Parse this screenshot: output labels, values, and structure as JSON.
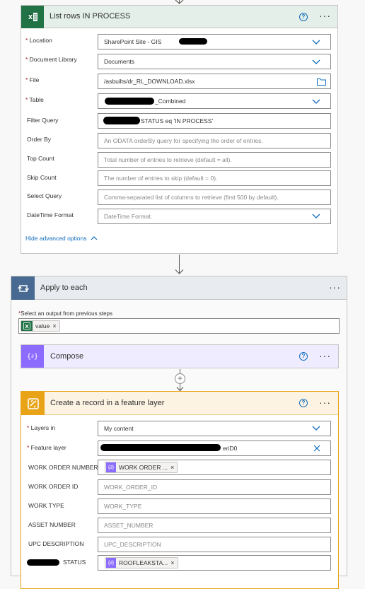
{
  "list_rows": {
    "title": "List rows IN PROCESS",
    "fields": [
      {
        "label": "Location",
        "required": true,
        "value": "SharePoint Site - GIS",
        "type": "dropdown"
      },
      {
        "label": "Document Library",
        "required": true,
        "value": "Documents",
        "type": "dropdown"
      },
      {
        "label": "File",
        "required": true,
        "value": "/asbuilts/dr_RL_DOWNLOAD.xlsx",
        "type": "file"
      },
      {
        "label": "Table",
        "required": true,
        "value": "_Combined",
        "type": "dropdown"
      },
      {
        "label": "Filter Query",
        "required": false,
        "value": "STATUS eq 'IN PROCESS'",
        "type": "text"
      },
      {
        "label": "Order By",
        "required": false,
        "placeholder": "An ODATA orderBy query for specifying the order of entries.",
        "type": "text"
      },
      {
        "label": "Top Count",
        "required": false,
        "placeholder": "Total number of entries to retrieve (default = all).",
        "type": "text"
      },
      {
        "label": "Skip Count",
        "required": false,
        "placeholder": "The number of entries to skip (default = 0).",
        "type": "text"
      },
      {
        "label": "Select Query",
        "required": false,
        "placeholder": "Comma-separated list of columns to retrieve (first 500 by default).",
        "type": "text"
      },
      {
        "label": "DateTime Format",
        "required": false,
        "placeholder": "DateTime Format.",
        "type": "dropdown"
      }
    ],
    "hide_advanced": "Hide advanced options"
  },
  "apply_each": {
    "title": "Apply to each",
    "select_label": "Select an output from previous steps",
    "token": "value"
  },
  "compose": {
    "title": "Compose"
  },
  "create_record": {
    "title": "Create a record in a feature layer",
    "fields": [
      {
        "label": "Layers in",
        "required": true,
        "value": "My content",
        "type": "dropdown"
      },
      {
        "label": "Feature layer",
        "required": true,
        "value": "eriD0",
        "type": "clear"
      },
      {
        "label": "WORK ORDER NUMBER",
        "required": false,
        "token": "WORK ORDER ...",
        "type": "token"
      },
      {
        "label": "WORK ORDER ID",
        "required": false,
        "placeholder": "WORK_ORDER_ID",
        "type": "text"
      },
      {
        "label": "WORK TYPE",
        "required": false,
        "placeholder": "WORK_TYPE",
        "type": "text"
      },
      {
        "label": "ASSET NUMBER",
        "required": false,
        "placeholder": "ASSET_NUMBER",
        "type": "text"
      },
      {
        "label": "UPC DESCRIPTION",
        "required": false,
        "placeholder": "UPC_DESCRIPTION",
        "type": "text"
      },
      {
        "label": "STATUS",
        "required": false,
        "token": "ROOFLEAKSTA...",
        "type": "token"
      }
    ]
  },
  "colors": {
    "excel_green": "#217346",
    "header_green": "#e3efe8",
    "loop_blue": "#486991",
    "compose_purple": "#8c6cff",
    "arcgis_orange": "#e8a317",
    "link_blue": "#0f6cbd"
  }
}
